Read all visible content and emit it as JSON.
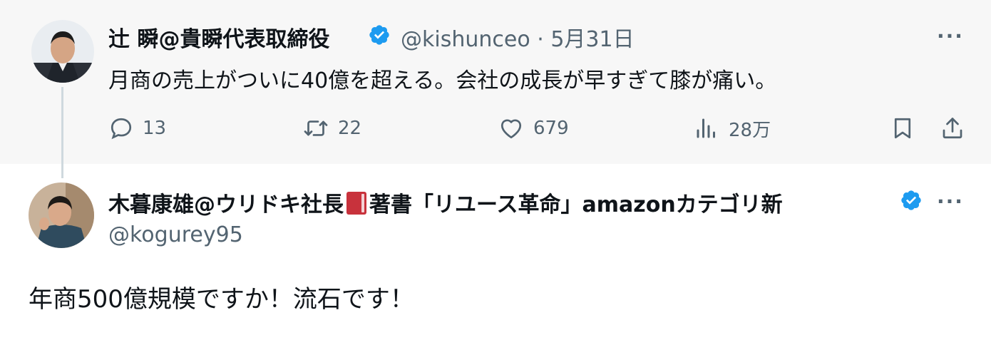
{
  "tweet1": {
    "display_name": "辻 瞬@貴瞬代表取締役",
    "handle": "@kishunceo",
    "separator": "·",
    "date": "5月31日",
    "more": "···",
    "text": "月商の売上がついに40億を超える。会社の成長が早すぎて膝が痛い。",
    "actions": {
      "reply_count": "13",
      "retweet_count": "22",
      "like_count": "679",
      "views_count": "28万"
    }
  },
  "tweet2": {
    "display_name_part1": "木暮康雄@ウリドキ社長",
    "display_name_part2": "著書「リユース革命」amazonカテゴリ新",
    "handle": "@kogurey95",
    "more": "···",
    "text": "年商500億規模ですか！流石です！"
  },
  "colors": {
    "verified": "#1d9bf0",
    "secondary_text": "#536471",
    "thread_line": "#cfd9de"
  },
  "icons": [
    "reply-icon",
    "retweet-icon",
    "like-icon",
    "views-icon",
    "bookmark-icon",
    "share-icon",
    "verified-badge-icon",
    "book-emoji-icon"
  ]
}
